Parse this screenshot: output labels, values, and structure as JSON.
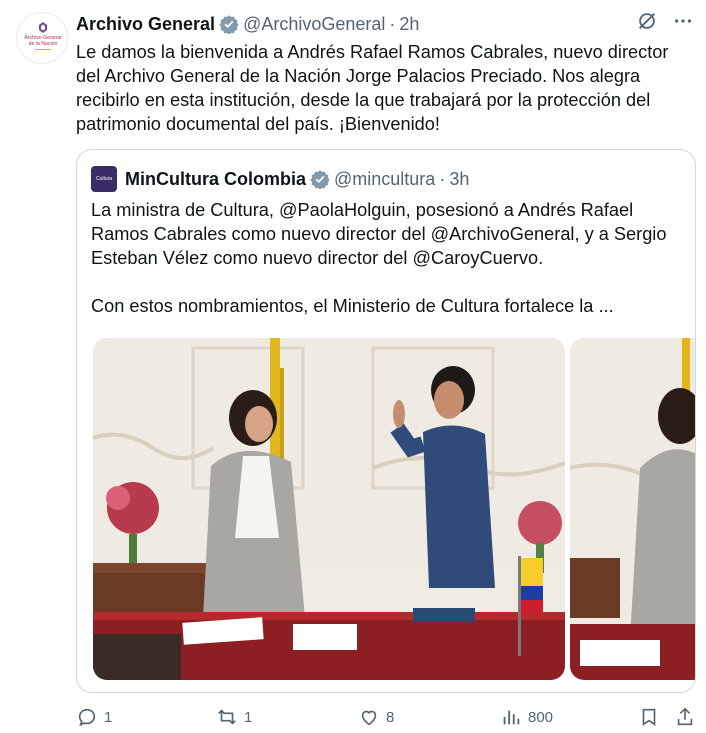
{
  "author": {
    "name": "Archivo General",
    "handle": "@ArchivoGeneral",
    "separator": "·",
    "time": "2h",
    "avatar_text": "Archivo General de la Nación"
  },
  "tweet_text": "Le damos la bienvenida a Andrés Rafael Ramos Cabrales, nuevo director del Archivo General de la Nación Jorge Palacios Preciado. Nos alegra recibirlo en esta institución, desde la que trabajará por la protección del patrimonio documental del país. ¡Bienvenido!",
  "quoted": {
    "name": "MinCultura Colombia",
    "handle": "@mincultura",
    "separator": "·",
    "time": "3h",
    "avatar_text": "Cultura",
    "paragraph1": "La ministra de Cultura, @PaolaHolguin, posesionó a Andrés Rafael Ramos Cabrales como nuevo director del @ArchivoGeneral, y a Sergio Esteban Vélez como nuevo director del @CaroyCuervo.",
    "paragraph2": "Con estos nombramientos, el Ministerio de Cultura fortalece la ..."
  },
  "actions": {
    "replies": "1",
    "reposts": "1",
    "likes": "8",
    "views": "800"
  },
  "colors": {
    "verified": "#829aab",
    "text": "#0f1419",
    "muted": "#536471",
    "border": "#cfd9de"
  }
}
